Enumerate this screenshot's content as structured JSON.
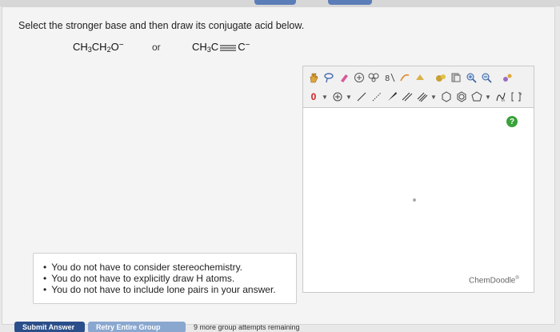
{
  "question": {
    "prompt": "Select the stronger base and then draw its conjugate acid below.",
    "molecule_a": {
      "parts": [
        "CH",
        "3",
        "CH",
        "2",
        "O",
        "−"
      ]
    },
    "separator": "or",
    "molecule_b": {
      "parts": [
        "CH",
        "3",
        "C",
        "C",
        "−"
      ]
    },
    "hints": [
      "You do not have to consider stereochemistry.",
      "You do not have to explicitly draw H atoms.",
      "You do not have to include lone pairs in your answer."
    ]
  },
  "editor": {
    "charge_value": "0",
    "help_label": "?",
    "brand": "ChemDoodle",
    "brand_mark": "®"
  },
  "actions": {
    "submit_label": "Submit Answer",
    "retry_label": "Retry Entire Group",
    "remaining_text": "9 more group attempts remaining"
  },
  "colors": {
    "accent": "#2b4f8a",
    "help": "#3aa23a"
  }
}
